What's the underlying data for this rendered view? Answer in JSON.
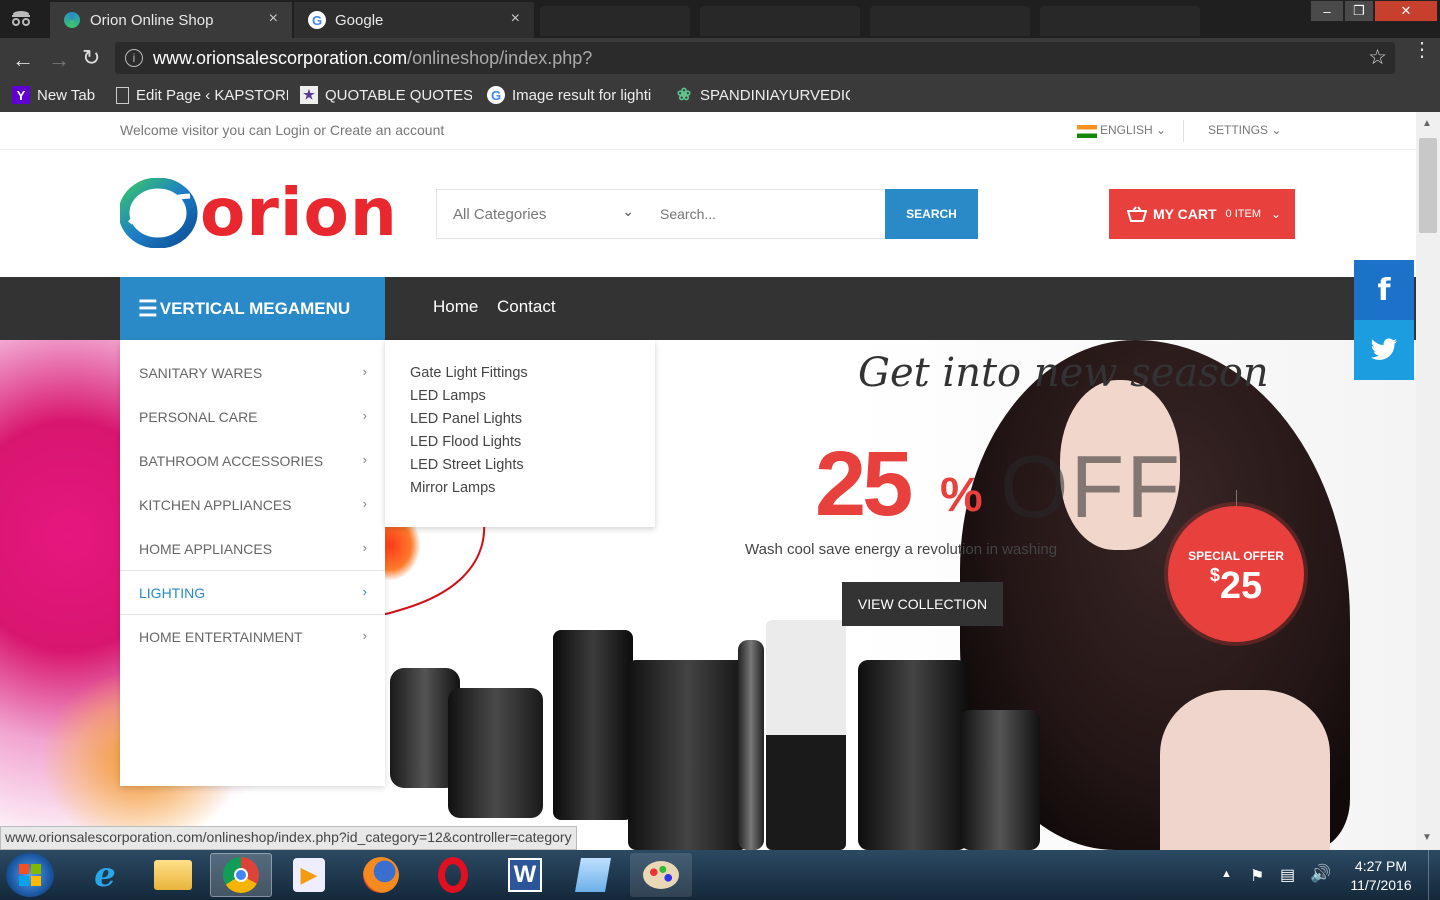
{
  "browser": {
    "tabs": [
      {
        "title": "Orion Online Shop",
        "close": "×"
      },
      {
        "title": "Google",
        "close": "×"
      }
    ],
    "window_controls": {
      "minimize": "–",
      "restore": "❐",
      "close": "✕"
    },
    "url_host": "www.orionsalescorporation.com",
    "url_path": "/onlineshop/index.php?",
    "bookmarks": [
      {
        "label": "New Tab",
        "icon": "yahoo-icon"
      },
      {
        "label": "Edit Page ‹ KAPSTORE",
        "icon": "page-icon"
      },
      {
        "label": "QUOTABLE QUOTES F",
        "icon": "quote-icon"
      },
      {
        "label": "Image result for lighti",
        "icon": "google-icon"
      },
      {
        "label": "SPANDINIAYURVEDIC",
        "icon": "leaf-icon"
      }
    ],
    "status_url": "www.orionsalescorporation.com/onlineshop/index.php?id_category=12&controller=category"
  },
  "site": {
    "welcome": "Welcome visitor you can Login or Create an account",
    "language": "ENGLISH",
    "settings": "SETTINGS",
    "logo_text": "orion",
    "category_select": "All Categories",
    "search_placeholder": "Search...",
    "search_button": "SEARCH",
    "cart_label": "MY CART",
    "cart_count": "0 ITEM",
    "megamenu_title": "VERTICAL MEGAMENU",
    "nav_links": [
      "Home",
      "Contact"
    ],
    "categories": [
      "SANITARY WARES",
      "PERSONAL CARE",
      "BATHROOM ACCESSORIES",
      "KITCHEN APPLIANCES",
      "HOME APPLIANCES",
      "LIGHTING",
      "HOME ENTERTAINMENT"
    ],
    "active_category": "LIGHTING",
    "lighting_submenu": [
      "Gate Light Fittings",
      "LED Lamps",
      "LED Panel Lights",
      "LED Flood Lights",
      "LED Street Lights",
      "Mirror Lamps"
    ],
    "hero": {
      "script_title": "Get into new season",
      "discount_number": "25",
      "discount_percent": "%",
      "discount_off": "OFF",
      "tagline": "Wash cool save energy a revolution in washing",
      "cta": "VIEW COLLECTION",
      "badge_title": "SPECIAL OFFER",
      "badge_currency": "$",
      "badge_price": "25"
    }
  },
  "taskbar": {
    "time": "4:27 PM",
    "date": "11/7/2016"
  },
  "colors": {
    "brand_blue": "#2a8ac8",
    "brand_red": "#e8403c",
    "nav_dark": "#333333",
    "social_blue": "#1c8fe0"
  }
}
